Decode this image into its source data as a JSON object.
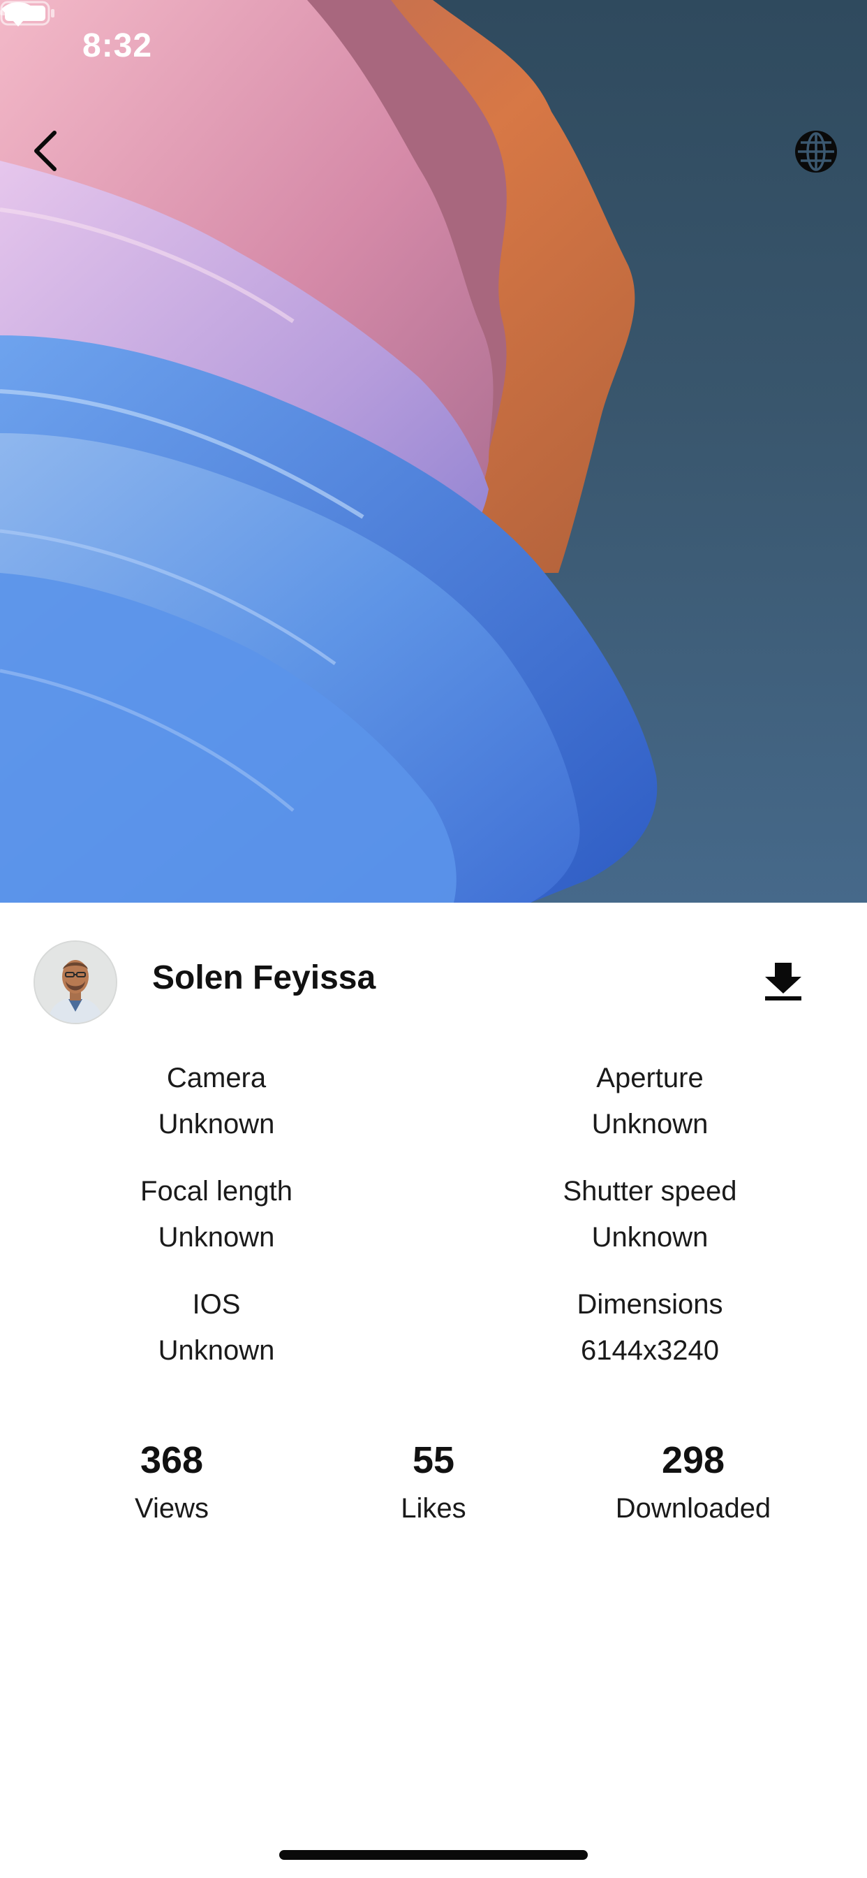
{
  "status_bar": {
    "time": "8:32",
    "icons": [
      "cellular-signal-icon",
      "wifi-icon",
      "battery-icon"
    ]
  },
  "nav": {
    "back_icon": "chevron-left-icon",
    "website_icon": "globe-icon"
  },
  "photo": {
    "description_colors": [
      "#2f4a5e",
      "#4a84df",
      "#d9a4c8",
      "#d9784a"
    ]
  },
  "author": {
    "name": "Solen Feyissa",
    "download_icon": "download-icon"
  },
  "exif": [
    {
      "label": "Camera",
      "value": "Unknown"
    },
    {
      "label": "Aperture",
      "value": "Unknown"
    },
    {
      "label": "Focal length",
      "value": "Unknown"
    },
    {
      "label": "Shutter speed",
      "value": "Unknown"
    },
    {
      "label": "IOS",
      "value": "Unknown"
    },
    {
      "label": "Dimensions",
      "value": "6144x3240"
    }
  ],
  "stats": [
    {
      "count": "368",
      "label": "Views"
    },
    {
      "count": "55",
      "label": "Likes"
    },
    {
      "count": "298",
      "label": "Downloaded"
    }
  ]
}
